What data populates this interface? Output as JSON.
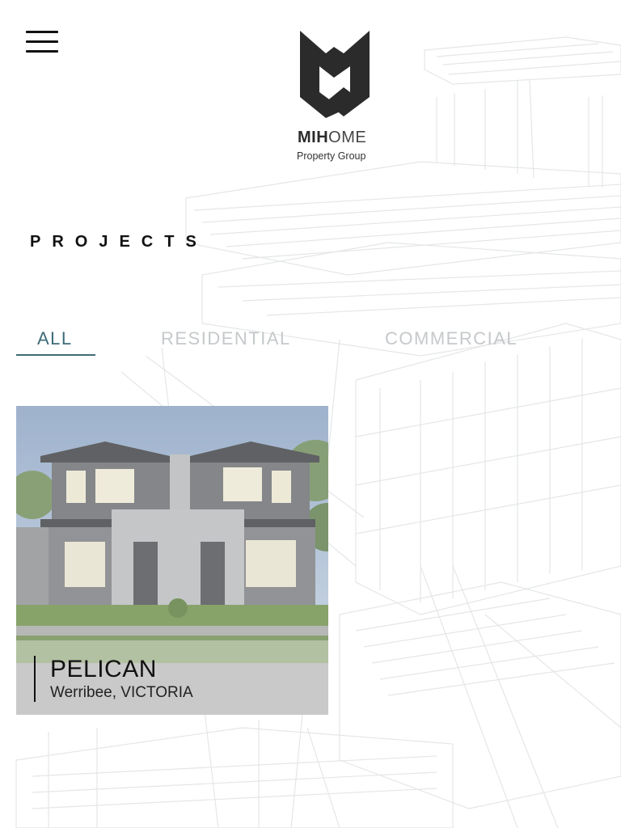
{
  "header": {
    "menu_icon": "hamburger-icon",
    "logo": {
      "icon": "mihome-logo-mark",
      "brand_bold": "MIH",
      "brand_light": "OME",
      "tagline": "Property Group"
    }
  },
  "page": {
    "title": "PROJECTS"
  },
  "filters": {
    "tabs": [
      {
        "label": "ALL",
        "active": true
      },
      {
        "label": "RESIDENTIAL",
        "active": false
      },
      {
        "label": "COMMERCIAL",
        "active": false
      }
    ]
  },
  "projects": [
    {
      "name": "PELICAN",
      "location": "Werribee, VICTORIA",
      "image": "double-storey-townhouse-render"
    }
  ],
  "colors": {
    "accent": "#3d6b78",
    "inactive_tab": "#c5c9cb",
    "text": "#111111",
    "logo": "#2b2b2b"
  }
}
